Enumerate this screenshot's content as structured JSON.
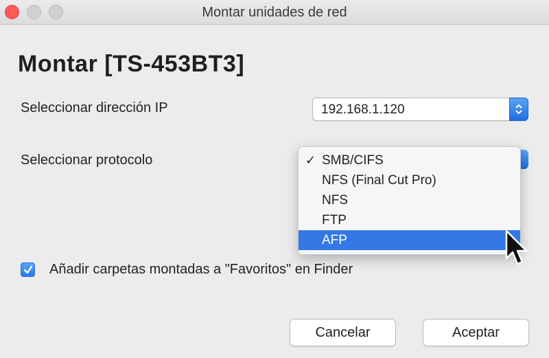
{
  "window": {
    "title": "Montar unidades de red"
  },
  "heading": "Montar [TS-453BT3]",
  "ip_row": {
    "label": "Seleccionar dirección IP",
    "selected": "192.168.1.120"
  },
  "protocol_row": {
    "label": "Seleccionar protocolo",
    "options": [
      {
        "label": "SMB/CIFS",
        "checked": true,
        "highlighted": false
      },
      {
        "label": "NFS (Final Cut Pro)",
        "checked": false,
        "highlighted": false
      },
      {
        "label": "NFS",
        "checked": false,
        "highlighted": false
      },
      {
        "label": "FTP",
        "checked": false,
        "highlighted": false
      },
      {
        "label": "AFP",
        "checked": false,
        "highlighted": true
      }
    ],
    "check_glyph": "✓"
  },
  "favorites_option": {
    "label": "Añadir carpetas montadas a \"Favoritos\" en Finder",
    "checked": true
  },
  "buttons": {
    "cancel": "Cancelar",
    "accept": "Aceptar"
  },
  "colors": {
    "accent": "#3478e6",
    "close": "#fc5b57"
  },
  "icons": {
    "stepper": "up-down-chevron-icon",
    "checkmark": "checkmark-icon",
    "cursor": "arrow-cursor-icon"
  }
}
